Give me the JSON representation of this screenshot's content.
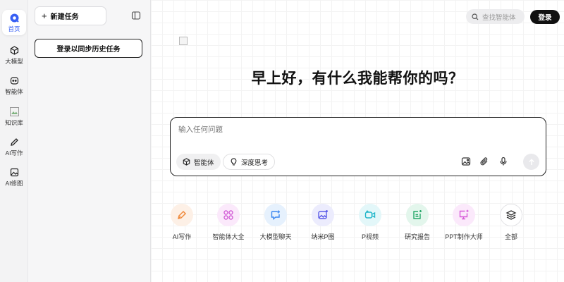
{
  "rail": {
    "items": [
      {
        "label": "首页"
      },
      {
        "label": "大模型"
      },
      {
        "label": "智能体"
      },
      {
        "label": "知识库"
      },
      {
        "label": "AI写作"
      },
      {
        "label": "AI修图"
      }
    ]
  },
  "panel": {
    "new_task_label": "新建任务",
    "login_history_label": "登录以同步历史任务"
  },
  "header": {
    "search_placeholder": "查找智能体",
    "login_label": "登录"
  },
  "main": {
    "greeting": "早上好，有什么我能帮你的吗？"
  },
  "chat": {
    "placeholder": "输入任何问题",
    "chips": [
      {
        "label": "智能体"
      },
      {
        "label": "深度思考"
      }
    ]
  },
  "quick_actions": [
    {
      "label": "AI写作",
      "color": "#f08a3c",
      "bg": "#fdf0e6"
    },
    {
      "label": "智能体大全",
      "color": "#d25cd6",
      "bg": "#fbe9fb"
    },
    {
      "label": "大模型聊天",
      "color": "#3a86f0",
      "bg": "#e6f1fd"
    },
    {
      "label": "纳米P图",
      "color": "#5b5ce8",
      "bg": "#ececfd"
    },
    {
      "label": "P视频",
      "color": "#1fb5c9",
      "bg": "#e3f7f9"
    },
    {
      "label": "研究报告",
      "color": "#26a86a",
      "bg": "#e3f6ec"
    },
    {
      "label": "PPT制作大师",
      "color": "#d65ad9",
      "bg": "#fbe9fb"
    },
    {
      "label": "全部",
      "color": "#333333",
      "bg": "#ffffff"
    }
  ],
  "colors": {
    "accent": "#3860f4",
    "primary_button": "#111111"
  }
}
